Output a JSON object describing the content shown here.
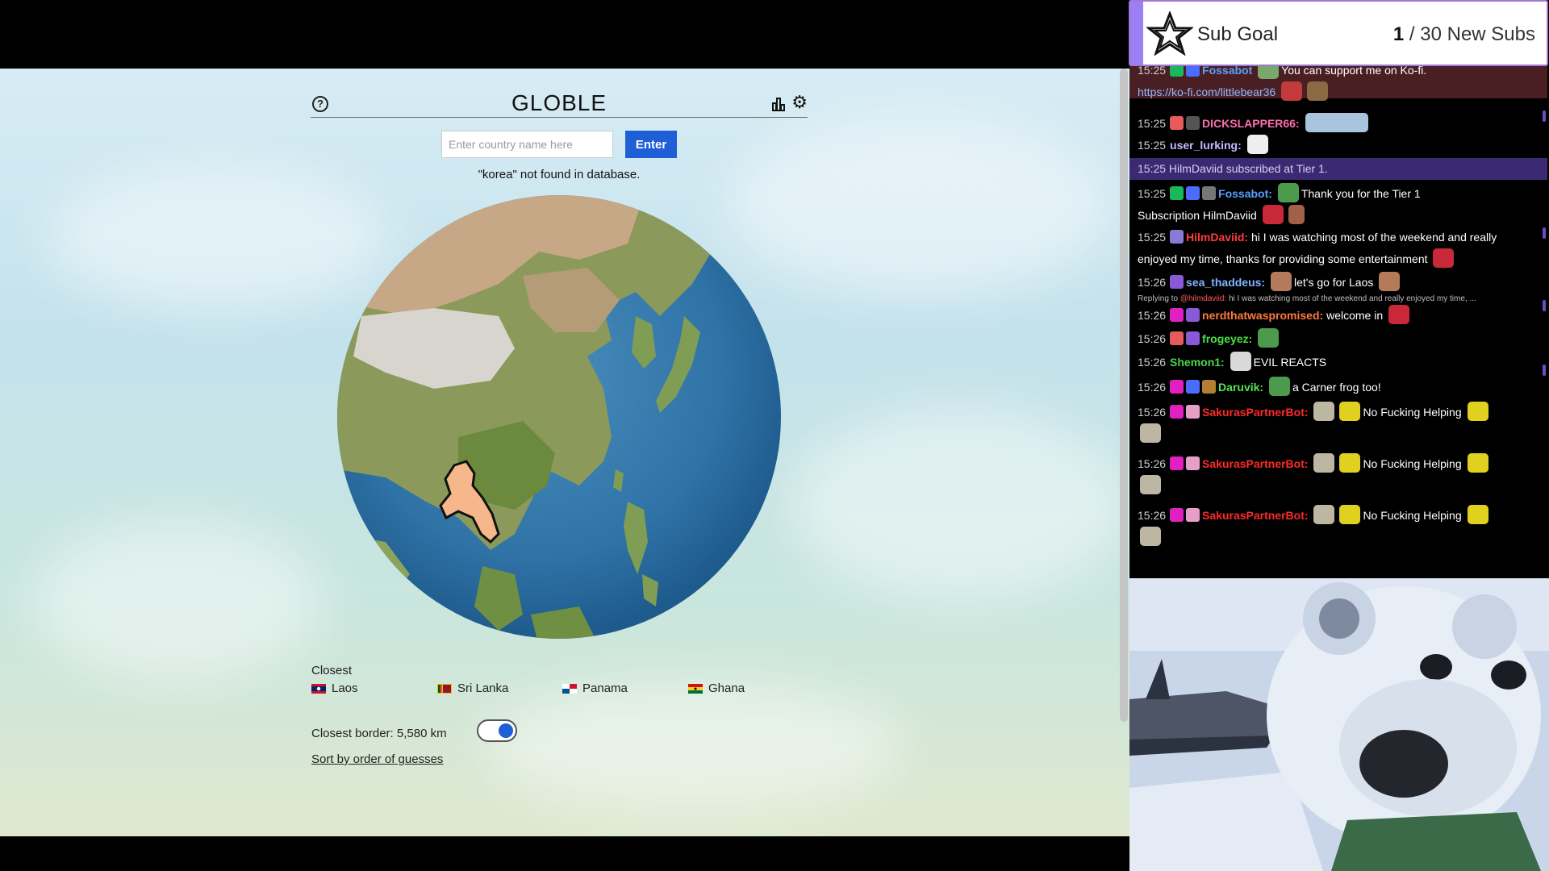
{
  "game": {
    "title": "GLOBLE",
    "input_placeholder": "Enter country name here",
    "enter_label": "Enter",
    "error_message": "\"korea\" not found in database.",
    "closest_label": "Closest",
    "closest": [
      {
        "name": "Laos",
        "flag": "laos-flag"
      },
      {
        "name": "Sri Lanka",
        "flag": "sri-lanka-flag"
      },
      {
        "name": "Panama",
        "flag": "panama-flag"
      },
      {
        "name": "Ghana",
        "flag": "ghana-flag"
      }
    ],
    "closest_border": "Closest border: 5,580 km",
    "toggle_on": true,
    "sort_link": "Sort by order of guesses",
    "highlighted_country": "Laos",
    "icons": {
      "help": "help-circle-icon",
      "stats": "bar-chart-icon",
      "settings": "gear-icon"
    }
  },
  "sub_goal": {
    "label": "Sub Goal",
    "current": "1",
    "target": " / 30 New Subs",
    "accent": "#9c7ff2"
  },
  "chat": {
    "messages": [
      {
        "time": "15:25",
        "user": "Fossabot",
        "text": "You can support me on Ko-fi.",
        "color": "#5aa0ff"
      },
      {
        "link": "https://ko-fi.com/littlebear36"
      },
      {
        "time": "15:25",
        "user": "DICKSLAPPER66:",
        "text": "",
        "color": "#ff6fb0"
      },
      {
        "time": "15:25",
        "user": "user_lurking:",
        "text": "",
        "color": "#c9b8ff"
      },
      {
        "system": "15:25 HilmDaviid subscribed at Tier 1."
      },
      {
        "time": "15:25",
        "user": "Fossabot:",
        "text": "Thank you for the Tier 1",
        "color": "#5aa0ff"
      },
      {
        "continuation": "Subscription HilmDaviid"
      },
      {
        "time": "15:25",
        "user": "HilmDaviid:",
        "text": "hi I was watching most of the weekend and really",
        "color": "#ff3c3c"
      },
      {
        "continuation": "enjoyed my time, thanks for providing some entertainment"
      },
      {
        "time": "15:26",
        "user": "sea_thaddeus:",
        "text": "let's go for Laos",
        "color": "#7fb4ff"
      },
      {
        "reply": "Replying to",
        "reply_user": "@hilmdaviid:",
        "reply_text": "hi I was watching most of the weekend and really enjoyed my time, ..."
      },
      {
        "time": "15:26",
        "user": "nerdthatwaspromised:",
        "text": "welcome in",
        "color": "#ff7a3c"
      },
      {
        "time": "15:26",
        "user": "frogeyez:",
        "text": "",
        "color": "#48e048"
      },
      {
        "time": "15:26",
        "user": "Shemon1:",
        "text": "EVIL REACTS",
        "color": "#4ad64a"
      },
      {
        "time": "15:26",
        "user": "Daruvik:",
        "text": "a Carner frog too!",
        "color": "#56e056"
      },
      {
        "time": "15:26",
        "user": "SakurasPartnerBot:",
        "text": "No Fucking Helping",
        "color": "#ff2a2a"
      },
      {
        "time": "15:26",
        "user": "SakurasPartnerBot:",
        "text": "No Fucking Helping",
        "color": "#ff2a2a"
      },
      {
        "time": "15:26",
        "user": "SakurasPartnerBot:",
        "text": "No Fucking Helping",
        "color": "#ff2a2a"
      }
    ]
  },
  "bear_cam": {
    "subject": "polar-bear-drawing"
  }
}
